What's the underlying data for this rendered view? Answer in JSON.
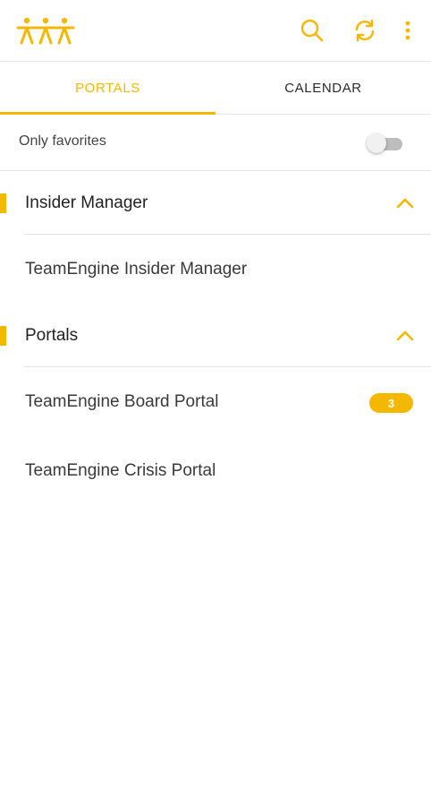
{
  "colors": {
    "accent": "#f5b800",
    "text": "#333333",
    "divider": "#e6e6e6"
  },
  "appbar": {
    "logo_icon": "teamengine-people-logo",
    "actions": [
      {
        "icon": "search-icon"
      },
      {
        "icon": "refresh-icon"
      },
      {
        "icon": "more-vertical-icon"
      }
    ]
  },
  "tabs": [
    {
      "label": "PORTALS",
      "active": true
    },
    {
      "label": "CALENDAR",
      "active": false
    }
  ],
  "favorites": {
    "label": "Only favorites",
    "enabled": false
  },
  "sections": [
    {
      "title": "Insider Manager",
      "expanded": true,
      "items": [
        {
          "label": "TeamEngine Insider Manager"
        }
      ]
    },
    {
      "title": "Portals",
      "expanded": true,
      "items": [
        {
          "label": "TeamEngine Board Portal",
          "badge": "3"
        },
        {
          "label": "TeamEngine Crisis Portal"
        }
      ]
    }
  ]
}
